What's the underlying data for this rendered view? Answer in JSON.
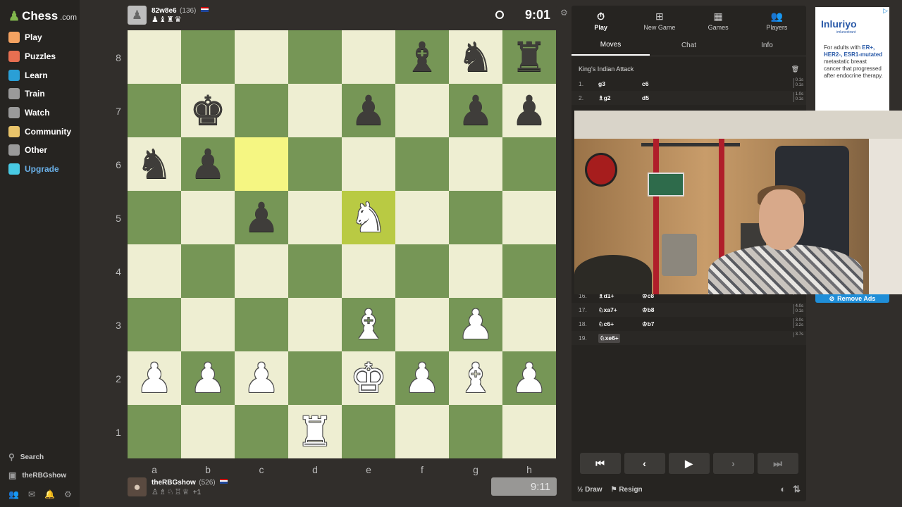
{
  "sidebar": {
    "logo_text": "Chess",
    "logo_suffix": ".com",
    "items": [
      {
        "label": "Play",
        "icon": "pawn-play-icon",
        "color": "#f4a261"
      },
      {
        "label": "Puzzles",
        "icon": "puzzle-icon",
        "color": "#e76f51"
      },
      {
        "label": "Learn",
        "icon": "learn-icon",
        "color": "#2a9fd6"
      },
      {
        "label": "Train",
        "icon": "train-icon",
        "color": "#9a9a9a"
      },
      {
        "label": "Watch",
        "icon": "binoculars-icon",
        "color": "#9a9a9a"
      },
      {
        "label": "Community",
        "icon": "community-icon",
        "color": "#e9c46a"
      },
      {
        "label": "Other",
        "icon": "more-dots-icon",
        "color": "#9a9a9a"
      },
      {
        "label": "Upgrade",
        "icon": "diamond-icon",
        "color": "#48cae4"
      }
    ],
    "search_label": "Search",
    "user_label": "theRBGshow"
  },
  "top_player": {
    "name": "82w8e6",
    "rating": "(136)",
    "captured": "♟♝♜♛",
    "clock": "9:01"
  },
  "bottom_player": {
    "name": "theRBGshow",
    "rating": "(526)",
    "captured": "♙♗♘♖♕",
    "advantage": "+1",
    "clock": "9:11"
  },
  "board": {
    "ranks": [
      "8",
      "7",
      "6",
      "5",
      "4",
      "3",
      "2",
      "1"
    ],
    "files": [
      "a",
      "b",
      "c",
      "d",
      "e",
      "f",
      "g",
      "h"
    ],
    "position": [
      [
        "",
        "",
        "",
        "",
        "",
        "b:♝",
        "b:♞",
        "b:♜"
      ],
      [
        "",
        "b:♚",
        "",
        "",
        "b:♟",
        "",
        "b:♟",
        "b:♟"
      ],
      [
        "b:♞",
        "b:♟",
        "",
        "",
        "",
        "",
        "",
        ""
      ],
      [
        "",
        "",
        "b:♟",
        "",
        "w:♞",
        "",
        "",
        ""
      ],
      [
        "",
        "",
        "",
        "",
        "",
        "",
        "",
        ""
      ],
      [
        "",
        "",
        "",
        "",
        "w:♝",
        "",
        "w:♟",
        ""
      ],
      [
        "w:♟",
        "w:♟",
        "w:♟",
        "",
        "w:♚",
        "w:♟",
        "w:♝",
        "w:♟"
      ],
      [
        "",
        "",
        "",
        "w:♜",
        "",
        "",
        "",
        ""
      ]
    ],
    "highlight_from": "c6",
    "highlight_to": "e5"
  },
  "panel": {
    "tabs": [
      {
        "label": "Play",
        "icon": "stopwatch-icon",
        "active": true
      },
      {
        "label": "New Game",
        "icon": "plus-icon",
        "active": false
      },
      {
        "label": "Games",
        "icon": "board-icon",
        "active": false
      },
      {
        "label": "Players",
        "icon": "players-icon",
        "active": false
      }
    ],
    "subtabs": [
      "Moves",
      "Chat",
      "Info"
    ],
    "opening": "King's Indian Attack",
    "moves": [
      {
        "num": "1.",
        "w": "g3",
        "b": "c6",
        "tw": "0.1s",
        "tb": "0.1s"
      },
      {
        "num": "2.",
        "w": "♗g2",
        "b": "d5",
        "tw": "1.0s",
        "tb": "0.1s"
      },
      {
        "num": "16.",
        "w": "♗d1+",
        "b": "♔c8",
        "tw": "",
        "tb": "4.3s"
      },
      {
        "num": "17.",
        "w": "♘xa7+",
        "b": "♔b8",
        "tw": "4.0s",
        "tb": "0.1s"
      },
      {
        "num": "18.",
        "w": "♘c6+",
        "b": "♔b7",
        "tw": "3.0s",
        "tb": "3.2s"
      },
      {
        "num": "19.",
        "w": "♘xe6+",
        "b": "",
        "tw": "3.7s",
        "tb": ""
      }
    ],
    "controls": [
      "⏮",
      "‹",
      "▶",
      "›",
      "⏭"
    ],
    "draw_label": "Draw",
    "resign_label": "Resign"
  },
  "ad": {
    "brand": "Inluriyo",
    "brand_sub": "imlunestrant",
    "text_a": "For adults with",
    "text_hl": "ER+, HER2-, ESR1-mutated",
    "text_b": "metastatic breast cancer that progressed after endocrine therapy.",
    "remove_label": "Remove Ads"
  }
}
